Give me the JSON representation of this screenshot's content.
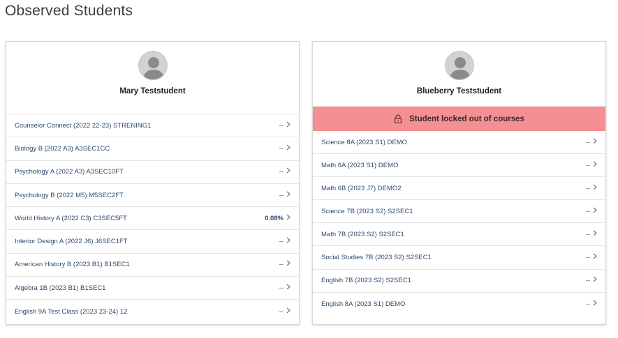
{
  "page": {
    "title": "Observed Students"
  },
  "students": [
    {
      "name": "Mary Teststudent",
      "locked": false,
      "courses": [
        {
          "name": "Counselor Connect (2022 22-23) STRENING1",
          "grade": "--"
        },
        {
          "name": "Biology B (2022 A3) A3SEC1CC",
          "grade": "--"
        },
        {
          "name": "Psychology A (2022 A3) A3SEC10FT",
          "grade": "--"
        },
        {
          "name": "Psychology B (2022 M5) M5SEC2FT",
          "grade": "--"
        },
        {
          "name": "World History A (2022 C3) C3SEC5FT",
          "grade": "0.08%"
        },
        {
          "name": "Interior Design A (2022 J6) J6SEC1FT",
          "grade": "--"
        },
        {
          "name": "American History B (2023 B1) B1SEC1",
          "grade": "--"
        },
        {
          "name": "Algebra 1B (2023 B1) B1SEC1",
          "grade": "--"
        },
        {
          "name": "English 9A Test Class (2023 23-24) 12",
          "grade": "--"
        }
      ]
    },
    {
      "name": "Blueberry Teststudent",
      "locked": true,
      "locked_message": "Student locked out of courses",
      "courses": [
        {
          "name": "Science 8A (2023 S1) DEMO",
          "grade": "--"
        },
        {
          "name": "Math 6A (2023 S1) DEMO",
          "grade": "--"
        },
        {
          "name": "Math 6B (2023 J7) DEMO2",
          "grade": "--"
        },
        {
          "name": "Science 7B (2023 S2) S2SEC1",
          "grade": "--"
        },
        {
          "name": "Math 7B (2023 S2) S2SEC1",
          "grade": "--"
        },
        {
          "name": "Social Studies 7B (2023 S2) S2SEC1",
          "grade": "--"
        },
        {
          "name": "English 7B (2023 S2) S2SEC1",
          "grade": "--"
        },
        {
          "name": "English 8A (2023 S1) DEMO",
          "grade": "--"
        }
      ]
    }
  ],
  "colors": {
    "locked_banner": "#f48f93",
    "link": "#2d4a6b"
  },
  "icons": {
    "avatar": "user-silhouette-icon",
    "lock": "lock-icon",
    "chevron": "chevron-right-icon"
  }
}
